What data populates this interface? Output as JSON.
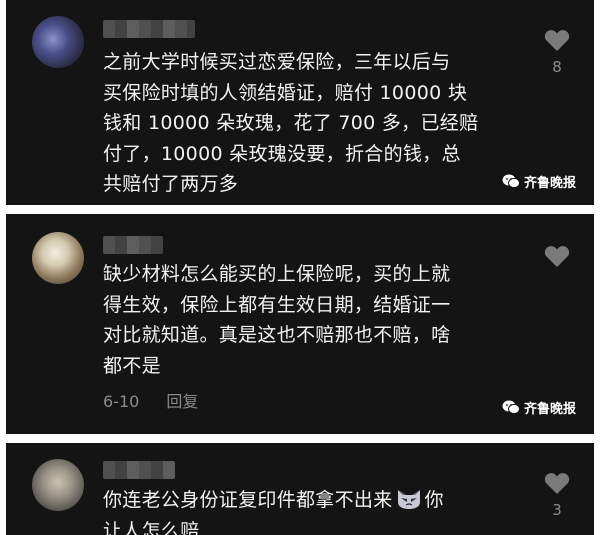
{
  "comments": [
    {
      "text_lines": "之前大学时候买过恋爱保险，三年以后与\n买保险时填的人领结婚证，赔付 10000 块\n钱和 10000 朵玫瑰，花了 700 多，已经赔\n付了，10000 朵玫瑰没要，折合的钱，总\n共赔付了两万多",
      "likes": "8",
      "watermark": "齐鲁晚报"
    },
    {
      "text_lines": "缺少材料怎么能买的上保险呢，买的上就\n得生效，保险上都有生效日期，结婚证一\n对比就知道。真是这也不赔那也不赔，啥\n都不是",
      "date": "6-10",
      "reply": "回复",
      "watermark": "齐鲁晚报"
    },
    {
      "text_before_emoji": "你连老公身份证复印件都拿不出来",
      "text_after_emoji": "你\n让人怎么赔",
      "likes": "3"
    }
  ],
  "icons": {
    "like": "heart-icon",
    "watermark": "wechat-icon",
    "emoji": "cat-emoji-icon"
  },
  "colors": {
    "panel_bg": "#141414",
    "text": "#f2f2f2",
    "muted": "#8a8a8a"
  }
}
